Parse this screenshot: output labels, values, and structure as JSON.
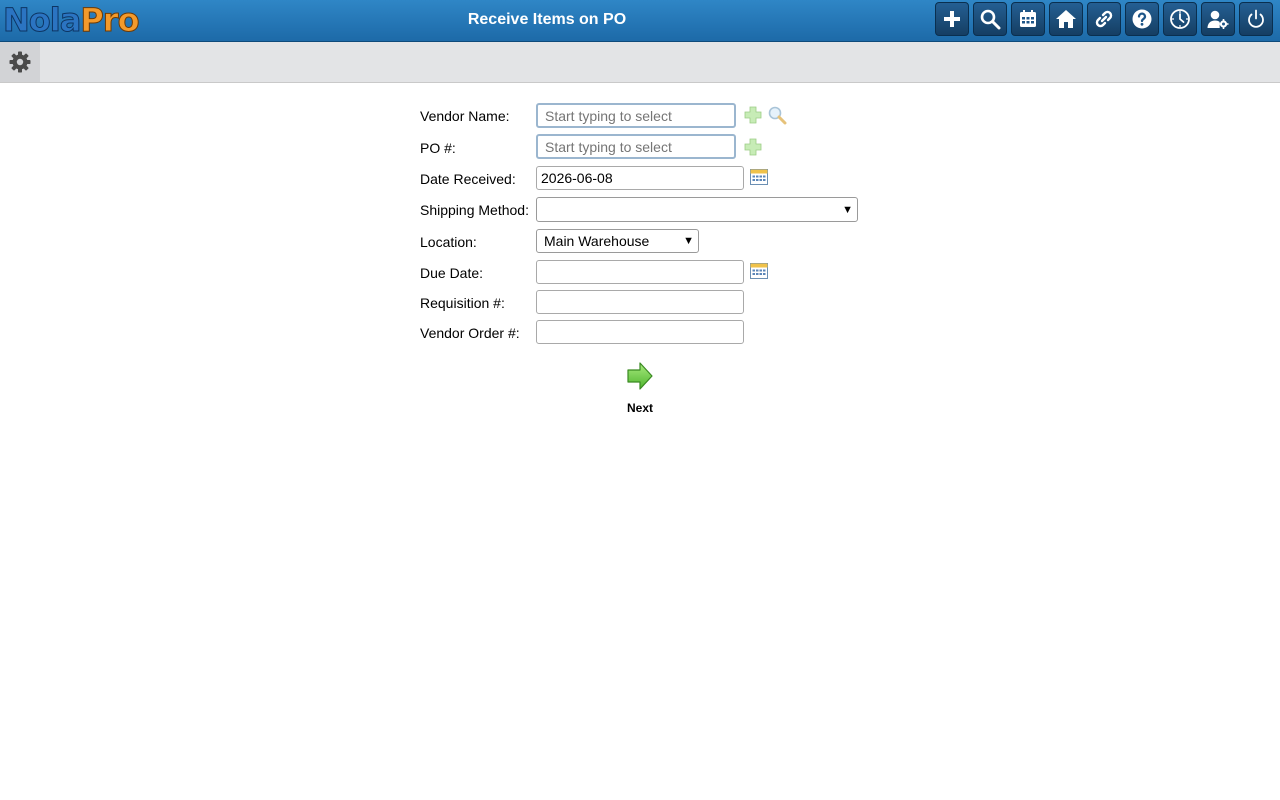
{
  "header": {
    "logo_part1": "Nola",
    "logo_part2": "Pro",
    "title": "Receive Items on PO",
    "buttons": [
      {
        "name": "add-icon"
      },
      {
        "name": "search-icon"
      },
      {
        "name": "calendar-icon"
      },
      {
        "name": "home-icon"
      },
      {
        "name": "link-icon"
      },
      {
        "name": "help-icon"
      },
      {
        "name": "clock-icon"
      },
      {
        "name": "user-settings-icon"
      },
      {
        "name": "power-icon"
      }
    ]
  },
  "toolbar": {
    "settings_icon": "gear-icon"
  },
  "form": {
    "vendor_name": {
      "label": "Vendor Name:",
      "value": "",
      "placeholder": "Start typing to select"
    },
    "po_number": {
      "label": "PO #:",
      "value": "",
      "placeholder": "Start typing to select"
    },
    "date_received": {
      "label": "Date Received:",
      "value": "2026-06-08"
    },
    "shipping_method": {
      "label": "Shipping Method:",
      "selected": ""
    },
    "location": {
      "label": "Location:",
      "selected": "Main Warehouse"
    },
    "due_date": {
      "label": "Due Date:",
      "value": ""
    },
    "requisition": {
      "label": "Requisition #:",
      "value": ""
    },
    "vendor_order": {
      "label": "Vendor Order #:",
      "value": ""
    }
  },
  "next_button": {
    "label": "Next"
  },
  "colors": {
    "header_blue": "#2f86c6",
    "logo_blue": "#2b74c2",
    "logo_orange": "#f39a2b",
    "next_green": "#6fcf4a"
  }
}
